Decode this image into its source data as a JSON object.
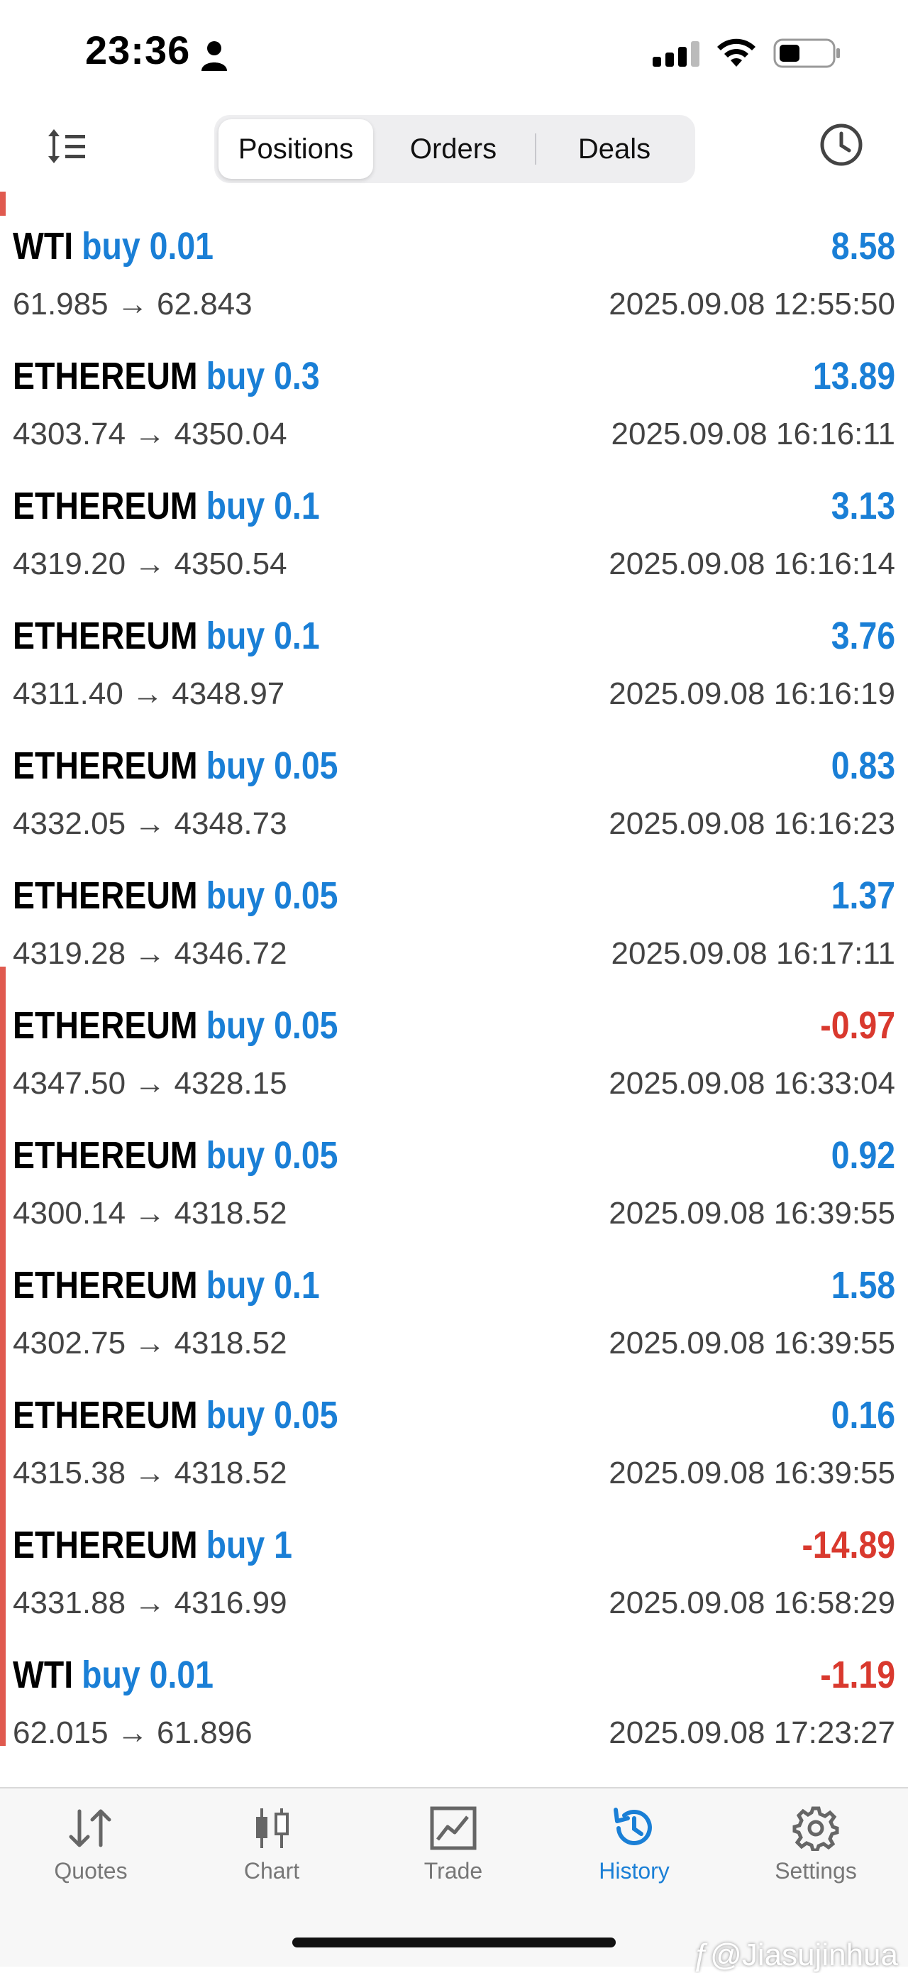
{
  "status": {
    "time": "23:36"
  },
  "tabs_segment": {
    "positions": "Positions",
    "orders": "Orders",
    "deals": "Deals"
  },
  "deals": [
    {
      "symbol": "WTI",
      "direction": "buy 0.01",
      "profit": "8.58",
      "profit_sign": "pos",
      "prices": "61.985 → 62.843",
      "time": "2025.09.08 12:55:50",
      "marker": false
    },
    {
      "symbol": "ETHEREUM",
      "direction": "buy 0.3",
      "profit": "13.89",
      "profit_sign": "pos",
      "prices": "4303.74 → 4350.04",
      "time": "2025.09.08 16:16:11",
      "marker": false
    },
    {
      "symbol": "ETHEREUM",
      "direction": "buy 0.1",
      "profit": "3.13",
      "profit_sign": "pos",
      "prices": "4319.20 → 4350.54",
      "time": "2025.09.08 16:16:14",
      "marker": false
    },
    {
      "symbol": "ETHEREUM",
      "direction": "buy 0.1",
      "profit": "3.76",
      "profit_sign": "pos",
      "prices": "4311.40 → 4348.97",
      "time": "2025.09.08 16:16:19",
      "marker": false
    },
    {
      "symbol": "ETHEREUM",
      "direction": "buy 0.05",
      "profit": "0.83",
      "profit_sign": "pos",
      "prices": "4332.05 → 4348.73",
      "time": "2025.09.08 16:16:23",
      "marker": false
    },
    {
      "symbol": "ETHEREUM",
      "direction": "buy 0.05",
      "profit": "1.37",
      "profit_sign": "pos",
      "prices": "4319.28 → 4346.72",
      "time": "2025.09.08 16:17:11",
      "marker": false
    },
    {
      "symbol": "ETHEREUM",
      "direction": "buy 0.05",
      "profit": "-0.97",
      "profit_sign": "neg",
      "prices": "4347.50 → 4328.15",
      "time": "2025.09.08 16:33:04",
      "marker": true
    },
    {
      "symbol": "ETHEREUM",
      "direction": "buy 0.05",
      "profit": "0.92",
      "profit_sign": "pos",
      "prices": "4300.14 → 4318.52",
      "time": "2025.09.08 16:39:55",
      "marker": true
    },
    {
      "symbol": "ETHEREUM",
      "direction": "buy 0.1",
      "profit": "1.58",
      "profit_sign": "pos",
      "prices": "4302.75 → 4318.52",
      "time": "2025.09.08 16:39:55",
      "marker": true
    },
    {
      "symbol": "ETHEREUM",
      "direction": "buy 0.05",
      "profit": "0.16",
      "profit_sign": "pos",
      "prices": "4315.38 → 4318.52",
      "time": "2025.09.08 16:39:55",
      "marker": true
    },
    {
      "symbol": "ETHEREUM",
      "direction": "buy 1",
      "profit": "-14.89",
      "profit_sign": "neg",
      "prices": "4331.88 → 4316.99",
      "time": "2025.09.08 16:58:29",
      "marker": true
    },
    {
      "symbol": "WTI",
      "direction": "buy 0.01",
      "profit": "-1.19",
      "profit_sign": "neg",
      "prices": "62.015 → 61.896",
      "time": "2025.09.08 17:23:27",
      "marker": true
    }
  ],
  "bottom_tabs": [
    {
      "label": "Quotes",
      "icon": "quotes-arrows-icon",
      "active": false
    },
    {
      "label": "Chart",
      "icon": "candlestick-icon",
      "active": false
    },
    {
      "label": "Trade",
      "icon": "trade-chart-icon",
      "active": false
    },
    {
      "label": "History",
      "icon": "history-icon",
      "active": true
    },
    {
      "label": "Settings",
      "icon": "gear-icon",
      "active": false
    }
  ],
  "watermark": "ƒ@Jiasujinhua",
  "colors": {
    "accent": "#1a7fd6",
    "negative": "#d9392e",
    "marker": "#e05a4f"
  }
}
